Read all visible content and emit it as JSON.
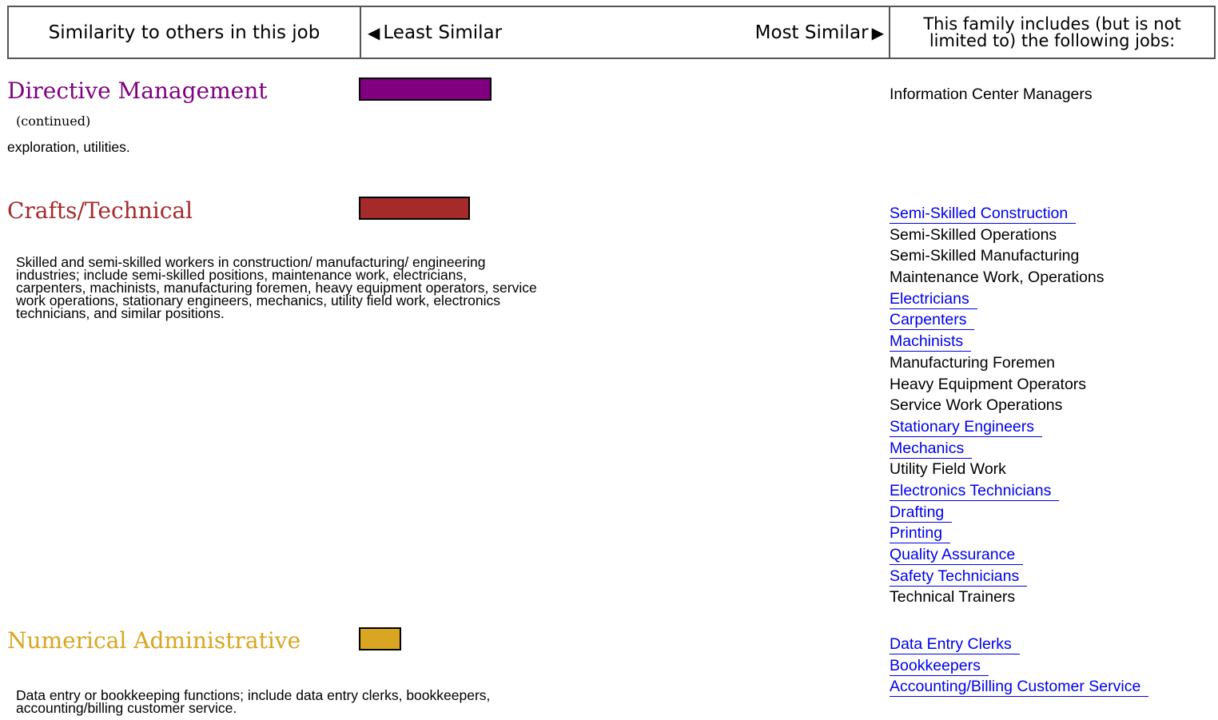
{
  "header": {
    "similarity_label": "Similarity to others in this job",
    "least_similar": "Least Similar",
    "most_similar": "Most Similar",
    "left_arrow": "◀",
    "right_arrow": "▶",
    "family_includes_line1": "This family includes (but is not",
    "family_includes_line2": "limited to) the following jobs:"
  },
  "colors": {
    "directive": "#800080",
    "crafts": "#a52a2a",
    "numerical": "#daa520",
    "link": "#0000ee"
  },
  "families": [
    {
      "title": "Directive Management",
      "continued": "(continued)",
      "description": "exploration, utilities.",
      "similarity": 0.25,
      "jobs": [
        {
          "label": "Information Center Managers",
          "link": false
        }
      ]
    },
    {
      "title": "Crafts/Technical",
      "description_lines": [
        "Skilled and semi-skilled workers in construction/ manufacturing/ engineering",
        "industries; include semi-skilled positions, maintenance work, electricians,",
        "carpenters, machinists, manufacturing foremen, heavy equipment operators, service",
        "work operations, stationary engineers, mechanics, utility field work, electronics",
        "technicians, and similar positions."
      ],
      "similarity": 0.21,
      "jobs": [
        {
          "label": "Semi-Skilled Construction",
          "link": true
        },
        {
          "label": "Semi-Skilled Operations",
          "link": false
        },
        {
          "label": "Semi-Skilled Manufacturing",
          "link": false
        },
        {
          "label": "Maintenance Work, Operations",
          "link": false
        },
        {
          "label": "Electricians",
          "link": true
        },
        {
          "label": "Carpenters",
          "link": true
        },
        {
          "label": "Machinists",
          "link": true
        },
        {
          "label": "Manufacturing Foremen",
          "link": false
        },
        {
          "label": "Heavy Equipment Operators",
          "link": false
        },
        {
          "label": "Service Work Operations",
          "link": false
        },
        {
          "label": "Stationary Engineers",
          "link": true
        },
        {
          "label": "Mechanics",
          "link": true
        },
        {
          "label": "Utility Field Work",
          "link": false
        },
        {
          "label": "Electronics Technicians",
          "link": true
        },
        {
          "label": "Drafting",
          "link": true
        },
        {
          "label": "Printing",
          "link": true
        },
        {
          "label": "Quality Assurance",
          "link": true
        },
        {
          "label": "Safety Technicians",
          "link": true
        },
        {
          "label": "Technical Trainers",
          "link": false
        }
      ]
    },
    {
      "title": "Numerical Administrative",
      "description_lines": [
        "Data entry or bookkeeping functions; include data entry clerks, bookkeepers,",
        "accounting/billing customer service."
      ],
      "similarity": 0.08,
      "jobs": [
        {
          "label": "Data Entry Clerks",
          "link": true
        },
        {
          "label": "Bookkeepers",
          "link": true
        },
        {
          "label": "Accounting/Billing Customer Service",
          "link": true
        }
      ]
    }
  ]
}
